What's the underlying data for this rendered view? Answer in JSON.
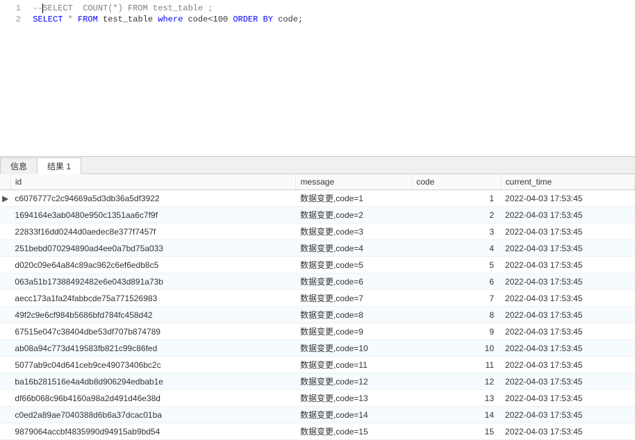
{
  "editor": {
    "lines": [
      {
        "num": "1",
        "segments": [
          {
            "cls": "comment",
            "text": " --"
          },
          {
            "cls": "cursor",
            "text": ""
          },
          {
            "cls": "comment",
            "text": "SELECT  COUNT(*) FROM test_table ;"
          }
        ]
      },
      {
        "num": "2",
        "segments": [
          {
            "cls": "",
            "text": " "
          },
          {
            "cls": "keyword",
            "text": "SELECT"
          },
          {
            "cls": "",
            "text": " "
          },
          {
            "cls": "star",
            "text": "*"
          },
          {
            "cls": "",
            "text": " "
          },
          {
            "cls": "keyword",
            "text": "FROM"
          },
          {
            "cls": "",
            "text": " test_table "
          },
          {
            "cls": "keyword",
            "text": "where"
          },
          {
            "cls": "",
            "text": " code<"
          },
          {
            "cls": "number",
            "text": "100"
          },
          {
            "cls": "",
            "text": " "
          },
          {
            "cls": "keyword",
            "text": "ORDER BY"
          },
          {
            "cls": "",
            "text": " code;"
          }
        ]
      }
    ]
  },
  "tabs": {
    "info": "信息",
    "result1": "结果 1"
  },
  "columns": {
    "id": "id",
    "message": "message",
    "code": "code",
    "current_time": "current_time"
  },
  "rows": [
    {
      "indicator": "▶",
      "id": "c6076777c2c94669a5d3db36a5df3922",
      "message": "数据变更,code=1",
      "code": "1",
      "current_time": "2022-04-03 17:53:45"
    },
    {
      "indicator": "",
      "id": "1694164e3ab0480e950c1351aa6c7f9f",
      "message": "数据变更,code=2",
      "code": "2",
      "current_time": "2022-04-03 17:53:45"
    },
    {
      "indicator": "",
      "id": "22833f16dd0244d0aedec8e377f7457f",
      "message": "数据变更,code=3",
      "code": "3",
      "current_time": "2022-04-03 17:53:45"
    },
    {
      "indicator": "",
      "id": "251bebd070294890ad4ee0a7bd75a033",
      "message": "数据变更,code=4",
      "code": "4",
      "current_time": "2022-04-03 17:53:45"
    },
    {
      "indicator": "",
      "id": "d020c09e64a84c89ac962c6ef6edb8c5",
      "message": "数据变更,code=5",
      "code": "5",
      "current_time": "2022-04-03 17:53:45"
    },
    {
      "indicator": "",
      "id": "063a51b17388492482e6e043d891a73b",
      "message": "数据变更,code=6",
      "code": "6",
      "current_time": "2022-04-03 17:53:45"
    },
    {
      "indicator": "",
      "id": "aecc173a1fa24fabbcde75a771526983",
      "message": "数据变更,code=7",
      "code": "7",
      "current_time": "2022-04-03 17:53:45"
    },
    {
      "indicator": "",
      "id": "49f2c9e6cf984b5686bfd784fc458d42",
      "message": "数据变更,code=8",
      "code": "8",
      "current_time": "2022-04-03 17:53:45"
    },
    {
      "indicator": "",
      "id": "67515e047c38404dbe53df707b874789",
      "message": "数据变更,code=9",
      "code": "9",
      "current_time": "2022-04-03 17:53:45"
    },
    {
      "indicator": "",
      "id": "ab08a94c773d419583fb821c99c86fed",
      "message": "数据变更,code=10",
      "code": "10",
      "current_time": "2022-04-03 17:53:45"
    },
    {
      "indicator": "",
      "id": "5077ab9c04d641ceb9ce49073406bc2c",
      "message": "数据变更,code=11",
      "code": "11",
      "current_time": "2022-04-03 17:53:45"
    },
    {
      "indicator": "",
      "id": "ba16b281516e4a4db8d906294edbab1e",
      "message": "数据变更,code=12",
      "code": "12",
      "current_time": "2022-04-03 17:53:45"
    },
    {
      "indicator": "",
      "id": "df66b068c96b4160a98a2d491d46e38d",
      "message": "数据变更,code=13",
      "code": "13",
      "current_time": "2022-04-03 17:53:45"
    },
    {
      "indicator": "",
      "id": "c0ed2a89ae7040388d6b6a37dcac01ba",
      "message": "数据变更,code=14",
      "code": "14",
      "current_time": "2022-04-03 17:53:45"
    },
    {
      "indicator": "",
      "id": "9879064accbf4835990d94915ab9bd54",
      "message": "数据变更,code=15",
      "code": "15",
      "current_time": "2022-04-03 17:53:45"
    }
  ]
}
